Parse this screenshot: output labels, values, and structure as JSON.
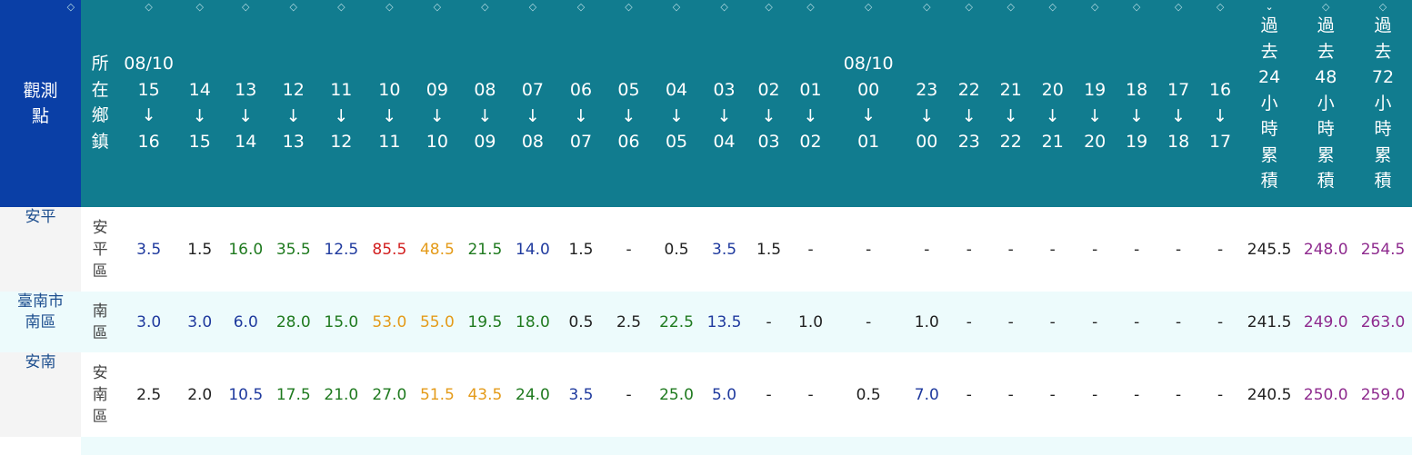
{
  "header": {
    "station_label": "觀測點",
    "town_label": "所在鄉鎮",
    "date_tags": [
      {
        "col": 0,
        "text": "08/10"
      },
      {
        "col": 15,
        "text": "08/10"
      }
    ],
    "hours": [
      {
        "from": "15",
        "to": "16"
      },
      {
        "from": "14",
        "to": "15"
      },
      {
        "from": "13",
        "to": "14"
      },
      {
        "from": "12",
        "to": "13"
      },
      {
        "from": "11",
        "to": "12"
      },
      {
        "from": "10",
        "to": "11"
      },
      {
        "from": "09",
        "to": "10"
      },
      {
        "from": "08",
        "to": "09"
      },
      {
        "from": "07",
        "to": "08"
      },
      {
        "from": "06",
        "to": "07"
      },
      {
        "from": "05",
        "to": "06"
      },
      {
        "from": "04",
        "to": "05"
      },
      {
        "from": "03",
        "to": "04"
      },
      {
        "from": "02",
        "to": "03"
      },
      {
        "from": "01",
        "to": "02"
      },
      {
        "from": "00",
        "to": "01"
      },
      {
        "from": "23",
        "to": "00"
      },
      {
        "from": "22",
        "to": "23"
      },
      {
        "from": "21",
        "to": "22"
      },
      {
        "from": "20",
        "to": "21"
      },
      {
        "from": "19",
        "to": "20"
      },
      {
        "from": "18",
        "to": "19"
      },
      {
        "from": "17",
        "to": "18"
      },
      {
        "from": "16",
        "to": "17"
      }
    ],
    "arrow": "↓",
    "accumulations": [
      {
        "chars": [
          "過",
          "去",
          "24",
          "小",
          "時",
          "累",
          "積"
        ],
        "sorted": true
      },
      {
        "chars": [
          "過",
          "去",
          "48",
          "小",
          "時",
          "累",
          "積"
        ],
        "sorted": false
      },
      {
        "chars": [
          "過",
          "去",
          "72",
          "小",
          "時",
          "累",
          "積"
        ],
        "sorted": false
      }
    ]
  },
  "rows": [
    {
      "station": [
        "安平"
      ],
      "town": [
        "安",
        "平",
        "區"
      ],
      "values": [
        {
          "v": "3.5",
          "c": "blue"
        },
        {
          "v": "1.5",
          "c": "gray"
        },
        {
          "v": "16.0",
          "c": "green"
        },
        {
          "v": "35.5",
          "c": "green"
        },
        {
          "v": "12.5",
          "c": "blue"
        },
        {
          "v": "85.5",
          "c": "red"
        },
        {
          "v": "48.5",
          "c": "orange"
        },
        {
          "v": "21.5",
          "c": "green"
        },
        {
          "v": "14.0",
          "c": "blue"
        },
        {
          "v": "1.5",
          "c": "gray"
        },
        {
          "v": "-",
          "c": "dash"
        },
        {
          "v": "0.5",
          "c": "gray"
        },
        {
          "v": "3.5",
          "c": "blue"
        },
        {
          "v": "1.5",
          "c": "gray"
        },
        {
          "v": "-",
          "c": "dash"
        },
        {
          "v": "-",
          "c": "dash"
        },
        {
          "v": "-",
          "c": "dash"
        },
        {
          "v": "-",
          "c": "dash"
        },
        {
          "v": "-",
          "c": "dash"
        },
        {
          "v": "-",
          "c": "dash"
        },
        {
          "v": "-",
          "c": "dash"
        },
        {
          "v": "-",
          "c": "dash"
        },
        {
          "v": "-",
          "c": "dash"
        },
        {
          "v": "-",
          "c": "dash"
        }
      ],
      "acc": [
        {
          "v": "245.5",
          "c": "gray"
        },
        {
          "v": "248.0",
          "c": "purple"
        },
        {
          "v": "254.5",
          "c": "purple"
        }
      ]
    },
    {
      "station": [
        "臺南市",
        "南區"
      ],
      "town": [
        "南",
        "區"
      ],
      "values": [
        {
          "v": "3.0",
          "c": "blue"
        },
        {
          "v": "3.0",
          "c": "blue"
        },
        {
          "v": "6.0",
          "c": "blue"
        },
        {
          "v": "28.0",
          "c": "green"
        },
        {
          "v": "15.0",
          "c": "green"
        },
        {
          "v": "53.0",
          "c": "orange"
        },
        {
          "v": "55.0",
          "c": "orange"
        },
        {
          "v": "19.5",
          "c": "green"
        },
        {
          "v": "18.0",
          "c": "green"
        },
        {
          "v": "0.5",
          "c": "gray"
        },
        {
          "v": "2.5",
          "c": "gray"
        },
        {
          "v": "22.5",
          "c": "green"
        },
        {
          "v": "13.5",
          "c": "blue"
        },
        {
          "v": "-",
          "c": "dash"
        },
        {
          "v": "1.0",
          "c": "gray"
        },
        {
          "v": "-",
          "c": "dash"
        },
        {
          "v": "1.0",
          "c": "gray"
        },
        {
          "v": "-",
          "c": "dash"
        },
        {
          "v": "-",
          "c": "dash"
        },
        {
          "v": "-",
          "c": "dash"
        },
        {
          "v": "-",
          "c": "dash"
        },
        {
          "v": "-",
          "c": "dash"
        },
        {
          "v": "-",
          "c": "dash"
        },
        {
          "v": "-",
          "c": "dash"
        }
      ],
      "acc": [
        {
          "v": "241.5",
          "c": "gray"
        },
        {
          "v": "249.0",
          "c": "purple"
        },
        {
          "v": "263.0",
          "c": "purple"
        }
      ]
    },
    {
      "station": [
        "安南"
      ],
      "town": [
        "安",
        "南",
        "區"
      ],
      "values": [
        {
          "v": "2.5",
          "c": "gray"
        },
        {
          "v": "2.0",
          "c": "gray"
        },
        {
          "v": "10.5",
          "c": "blue"
        },
        {
          "v": "17.5",
          "c": "green"
        },
        {
          "v": "21.0",
          "c": "green"
        },
        {
          "v": "27.0",
          "c": "green"
        },
        {
          "v": "51.5",
          "c": "orange"
        },
        {
          "v": "43.5",
          "c": "orange"
        },
        {
          "v": "24.0",
          "c": "green"
        },
        {
          "v": "3.5",
          "c": "blue"
        },
        {
          "v": "-",
          "c": "dash"
        },
        {
          "v": "25.0",
          "c": "green"
        },
        {
          "v": "5.0",
          "c": "blue"
        },
        {
          "v": "-",
          "c": "dash"
        },
        {
          "v": "-",
          "c": "dash"
        },
        {
          "v": "0.5",
          "c": "gray"
        },
        {
          "v": "7.0",
          "c": "blue"
        },
        {
          "v": "-",
          "c": "dash"
        },
        {
          "v": "-",
          "c": "dash"
        },
        {
          "v": "-",
          "c": "dash"
        },
        {
          "v": "-",
          "c": "dash"
        },
        {
          "v": "-",
          "c": "dash"
        },
        {
          "v": "-",
          "c": "dash"
        },
        {
          "v": "-",
          "c": "dash"
        }
      ],
      "acc": [
        {
          "v": "240.5",
          "c": "gray"
        },
        {
          "v": "250.0",
          "c": "purple"
        },
        {
          "v": "259.0",
          "c": "purple"
        }
      ]
    }
  ],
  "colors": {
    "header_bg": "#117c8f",
    "station_header_bg": "#0a3fa6",
    "row_tint": "#edfbfc",
    "blue": "#1f3a9e",
    "green": "#1f7a1f",
    "orange": "#e49b1a",
    "red": "#d21f1f",
    "purple": "#8e2a8e"
  },
  "icons": {
    "sort": "sort-updown-icon",
    "sort_active": "sort-desc-icon"
  }
}
